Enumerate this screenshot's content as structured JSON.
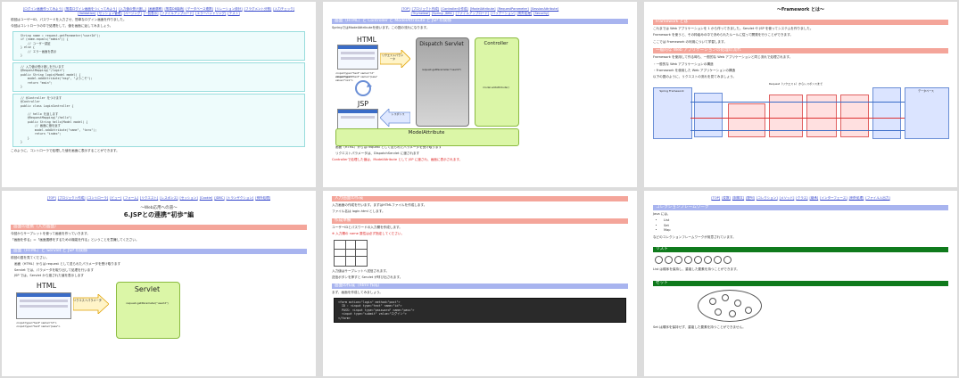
{
  "t1": {
    "nav_line1": [
      "ログイン画面作ってみよう",
      "簡易ログイン画面をつくってみよう",
      "入力値の受け渡し",
      "画面遷移",
      "簡易DB接続",
      "データベース連携",
      "リレーション設計",
      "フラグメント分割",
      "入力チェック"
    ],
    "nav_line2": [
      "Validation",
      "セッション管理",
      "ページング",
      "一覧表示",
      "ファイルアップロード",
      "エラーハンドリング",
      "テスト"
    ],
    "intro": "前回はユーザーID、パスワードを入力させ、簡単なログイン画面を作りました。",
    "intro2": "今回はコントローラの中で処理をして、値を画面に返してみましょう。",
    "code1": "  String name = request.getParameter(\"userId\");\n  if (name.equals(\"admin\")) {\n      // ユーザー認証\n  } else {\n      // エラー画面を表示\n  }",
    "code2": "  // 入力値の受け渡しを行います\n  @RequestMapping(\"/login\")\n  public String login(Model model) {\n      model.addAttribute(\"msg\", \"ようこそ\");\n      return \"main\";\n  }",
    "code3": "  // @Controller をつけます\n  @Controller\n  public class LoginController {\n\n      // hello を返します\n      @RequestMapping(\"/hello\")\n      public String hello(Model model) {\n          // 画面に値を返す\n          model.addAttribute(\"name\", \"taro\");\n          return \"index\";\n      }\n  }",
    "footer": "このように、コントローラで処理した値を画面に表示することができます。"
  },
  "t2": {
    "nav_line1": [
      "TOP",
      "プロジェクト作成",
      "Controllerの作成",
      "ModelAttribute",
      "RequestParameter",
      "SessionAttribute"
    ],
    "nav_line2": [
      "Thymeleaf",
      "Spring JDBC",
      "ファイルアップロード",
      "バリデーション",
      "例外処理",
      "Security"
    ],
    "heading": "画面（HTML）と Controller と ModelAttribute と JSP の関係",
    "lead": "SpringではModelAttributeを使います。この図の流れになります。",
    "html_label": "HTML",
    "jsp_label": "JSP",
    "servlet_label": "Dispatch Servlet",
    "controller_label": "Controller",
    "request_label": "リクエストパラメータ",
    "response_label": "レスポンス",
    "model_label": "ModelAttribute",
    "servlet_note": "request.getParameter(\"userId\")",
    "controller_note": "model.addAttribute()",
    "bullet1": "画面（HTML）からは request として送られたパラメータを受け取ります",
    "bullet2": "リクエストパラメータは、DispatchServlet に渡されます",
    "red_note": "Controllerで処理した値は、ModelAttribute として JSP に渡され、画面に表示されます。",
    "input_line1": "<input type=\"text\" name=\"id\" value=\"xxx\">",
    "input_line2": "<input type=\"text\" name=\"pass\" value=\"xxx\">"
  },
  "t3": {
    "title": "〜Framework とは〜",
    "heading1": "Framework とは",
    "p1": "これまでは Web アプリケーションを 1 から作ってきました。Servlet や JSP を使ってシステムを作りました。",
    "p2": "Framework を使うと、その枠組みの中で決められたルールに従って開発を行うことができます。",
    "p3": "ここでは Framework の利用について学習します。",
    "heading2": "一般的な Web アプリケーションの処理の流れ",
    "p4": "Framework を使用して作る時も、一般的な Web アプリケーションと同じ流れで処理されます。",
    "p5": "・一般的な Web アプリケーションの構造",
    "p6": "・Framework を使用した Web アプリケーションの構造",
    "p7": "以下の図のように、リクエストの流れを見てみましょう。",
    "diag_title": "Request（リクエスト）からレスポンスまで",
    "diag_left": "Spring Framework",
    "diag_right": "データベース"
  },
  "t4": {
    "nav": [
      "TOP",
      "プロジェクト作成",
      "コントローラ",
      "ビュー",
      "フォーム",
      "リクエスト",
      "レスポンス",
      "セッション",
      "Cookie",
      "JDBC",
      "トランザクション",
      "例外処理"
    ],
    "subtitle": "〜Web応用への道〜",
    "title": "6.JSPとの連携“初歩”編",
    "heading1": "画面の連携（入力画面）",
    "p1": "今回からサーブレットを使って画面を作っていきます。",
    "p2": "「画面を作る」＝「画面遷移をするための機能を作る」ということを意識してください。",
    "heading2": "画面（HTML）と Servlet と JSP の関係",
    "p3": "前回の図を見てください。",
    "bullet1": "画面（HTML）からは request として送られたパラメータを受け取ります",
    "bullet2": "Servlet では、パラメータを取り出して処理を行います",
    "bullet3": "JSP では、Servlet から渡された値を表示します",
    "html_label": "HTML",
    "servlet_label": "Servlet",
    "request_label": "リクエストパラメータ",
    "servlet_note": "request.getParameter(\"userId\")",
    "input_line1": "<input type=\"text\" name=\"id\">",
    "input_line2": "<input type=\"text\" name=\"pass\">"
  },
  "t5": {
    "heading1": "入力画面の作成",
    "p1": "入力画面の作成を行います。まずはHTMLファイルを作成します。",
    "p2": "ファイル名は login.html とします。",
    "heading2": "作成準備",
    "p3": "ユーザーIDとパスワードの入力欄を作成します。",
    "red_note": "※ 入力欄の name 属性は必ず指定してください。",
    "p4": "入力値はサーブレットへ送信されます。",
    "p5": "送信ボタンを押すと Servlet が呼び出されます。",
    "heading3": "画面の作成（html 作成）",
    "p6": "まず、画面を作成してみましょう。",
    "code": "<form action=\"login\" method=\"post\">\n  ID : <input type=\"text\" name=\"id\">\n  PASS: <input type=\"password\" name=\"pass\">\n  <input type=\"submit\" value=\"ログイン\">\n</form>"
  },
  "t6": {
    "nav": [
      "TOP",
      "変数",
      "制御文",
      "配列",
      "コレクション",
      "メソッド",
      "クラス",
      "継承",
      "インターフェース",
      "例外処理",
      "ファイル入出力"
    ],
    "heading1": "コレクションフレームワーク",
    "p1": "Java には、",
    "list": [
      "List",
      "Set",
      "Map"
    ],
    "p2": "などのコレクションフレームワークが用意されています。",
    "heading2": "リスト",
    "list_note": "List は順序を保持し、重複した要素を持つことができます。",
    "heading3": "セット",
    "set_note": "Set は順序を保持せず、重複した要素を持つことができません。"
  }
}
